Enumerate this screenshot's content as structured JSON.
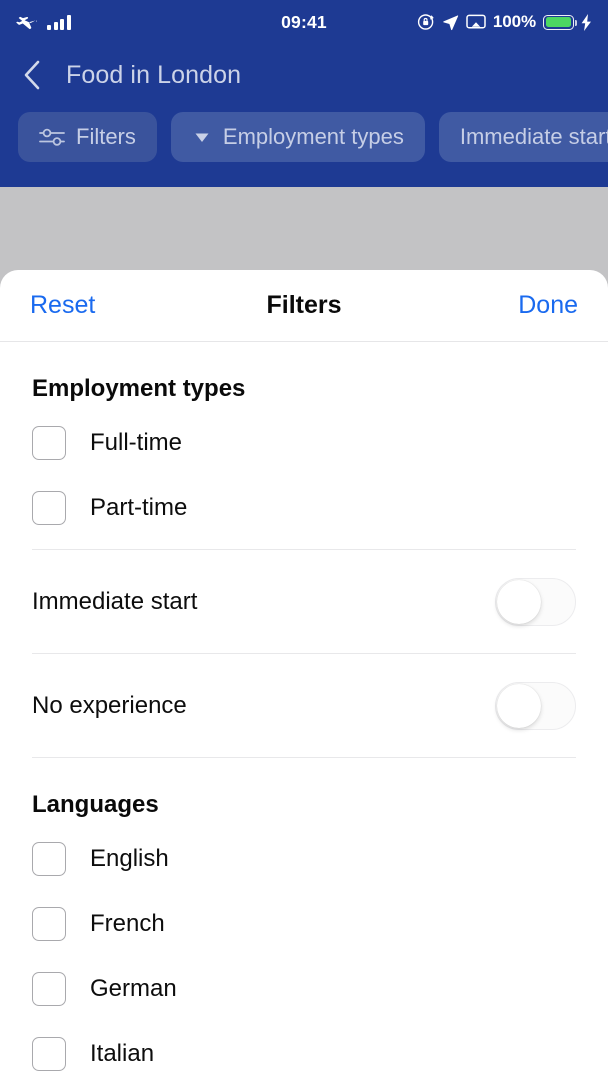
{
  "status_bar": {
    "airplane_icon": "airplane-mode-icon",
    "signal_icon": "cellular-signal-icon",
    "time": "09:41",
    "rotation_lock_icon": "rotation-lock-icon",
    "location_icon": "location-arrow-icon",
    "airplay_icon": "screen-mirroring-icon",
    "battery_percent": "100%",
    "battery_icon": "battery-icon",
    "charging_icon": "charging-bolt-icon",
    "battery_color": "#4cd762"
  },
  "nav": {
    "back_icon": "chevron-left-icon",
    "title": "Food in London"
  },
  "chips": [
    {
      "label": "Filters",
      "icon": "sliders-icon",
      "accent": false
    },
    {
      "label": "Employment types",
      "icon": "chevron-down-icon",
      "accent": true
    },
    {
      "label": "Immediate start",
      "icon": "",
      "accent": true
    }
  ],
  "sheet": {
    "reset_label": "Reset",
    "title": "Filters",
    "done_label": "Done",
    "link_color": "#1a6aef",
    "sections": {
      "employment": {
        "title": "Employment types",
        "options": [
          {
            "label": "Full-time",
            "checked": false
          },
          {
            "label": "Part-time",
            "checked": false
          }
        ]
      },
      "toggles": [
        {
          "label": "Immediate start",
          "on": false
        },
        {
          "label": "No experience",
          "on": false
        }
      ],
      "languages": {
        "title": "Languages",
        "options": [
          {
            "label": "English",
            "checked": false
          },
          {
            "label": "French",
            "checked": false
          },
          {
            "label": "German",
            "checked": false
          },
          {
            "label": "Italian",
            "checked": false
          }
        ]
      }
    }
  },
  "background": {
    "photo_alt": "food-photo-wrap"
  },
  "theme": {
    "header_blue": "#1e3a93",
    "chip_blue": "#3a539c"
  }
}
